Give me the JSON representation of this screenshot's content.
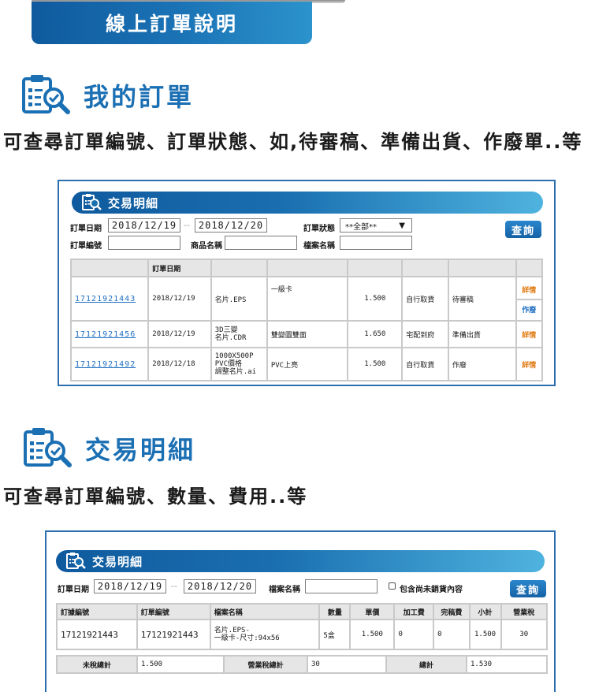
{
  "banner": {
    "title": "線上訂單說明"
  },
  "section1": {
    "title": "我的訂單",
    "desc": "可查尋訂單編號、訂單狀態、如,待審稿、準備出貨、作廢單..等"
  },
  "panel1": {
    "title": "交易明細",
    "order_date_label": "訂單日期",
    "date_from": "2018/12/19",
    "date_to": "2018/12/20",
    "date_sep": "--",
    "status_label": "訂單狀態",
    "status_value": "**全部**",
    "query_label": "查詢",
    "order_no_label": "訂單編號",
    "product_label": "商品名稱",
    "file_label": "檔案名稱",
    "table_header_date": "訂單日期",
    "rows": [
      {
        "order_no": "17121921443",
        "date": "2018/12/19",
        "product": "名片.EPS",
        "file": "一級卡",
        "price": "1.500",
        "delivery": "自行取貨",
        "status": "待審稿",
        "action1": "詳情",
        "action2": "作廢"
      },
      {
        "order_no": "17121921456",
        "date": "2018/12/19",
        "product": "3D三變\n名片.CDR",
        "file": "雙變圖雙面",
        "price": "1.650",
        "delivery": "宅配到府",
        "status": "準備出貨",
        "action1": "詳情"
      },
      {
        "order_no": "17121921492",
        "date": "2018/12/18",
        "product": "1000X500P\nPVC價格\n調整名片.ai",
        "file": "PVC上亮",
        "price": "1.500",
        "delivery": "自行取貨",
        "status": "作廢",
        "action1": "詳情"
      }
    ]
  },
  "section2": {
    "title": "交易明細",
    "desc": "可查尋訂單編號、數量、費用..等"
  },
  "panel2": {
    "title": "交易明細",
    "order_date_label": "訂單日期",
    "date_from": "2018/12/19",
    "date_to": "2018/12/20",
    "date_sep": "--",
    "file_label": "檔案名稱",
    "checkbox_label": "包含尚未銷貨內容",
    "query_label": "查詢",
    "headers": [
      "訂據編號",
      "訂單編號",
      "檔案名稱",
      "數量",
      "單價",
      "加工費",
      "完稿費",
      "小計",
      "營業稅"
    ],
    "row": {
      "voucher_no": "17121921443",
      "order_no": "17121921443",
      "file": "名片.EPS-\n一級卡-尺寸:94x56",
      "qty": "5盒",
      "unit_price": "1.500",
      "processing": "0",
      "design": "0",
      "subtotal": "1.500",
      "tax": "30"
    },
    "summary": {
      "pretax_label": "未稅總計",
      "pretax_value": "1.500",
      "tax_label": "營業稅總計",
      "tax_value": "30",
      "total_label": "總計",
      "total_value": "1.530"
    }
  },
  "colors": {
    "brand_blue": "#1b6fb3",
    "link_blue": "#1f6fc2",
    "action_orange": "#e07a12"
  },
  "icons": [
    "clipboard-search-icon"
  ]
}
